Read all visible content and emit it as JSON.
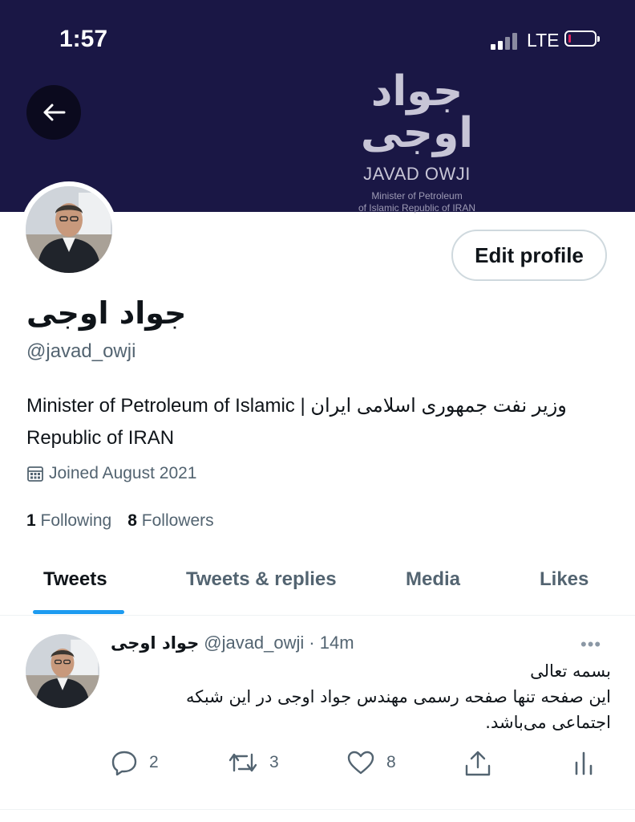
{
  "status_bar": {
    "time": "1:57",
    "network": "LTE"
  },
  "banner": {
    "logo_fa": "جواد اوجی",
    "logo_en": "JAVAD OWJI",
    "logo_sub1": "Minister of Petroleum",
    "logo_sub2": "of Islamic Republic of IRAN",
    "color": "#1a1745"
  },
  "profile": {
    "name": "جواد اوجی",
    "handle": "@javad_owji",
    "bio": "Minister of Petroleum of Islamic | وزیر نفت جمهوری اسلامی ایران Republic of IRAN",
    "joined": "Joined August 2021",
    "following_count": "1",
    "following_label": "Following",
    "followers_count": "8",
    "followers_label": "Followers",
    "edit_label": "Edit profile"
  },
  "tabs": [
    {
      "label": "Tweets",
      "active": true
    },
    {
      "label": "Tweets & replies",
      "active": false
    },
    {
      "label": "Media",
      "active": false
    },
    {
      "label": "Likes",
      "active": false
    }
  ],
  "tweet": {
    "name": "جواد اوجی",
    "handle": "@javad_owji",
    "time": "· 14m",
    "line1": "بسمه تعالی",
    "line2": "این صفحه تنها صفحه رسمی مهندس جواد اوجی در این شبکه اجتماعی می‌باشد.",
    "replies": "2",
    "retweets": "3",
    "likes": "8",
    "more": "•••"
  },
  "colors": {
    "accent": "#1d9bf0",
    "muted": "#536471",
    "text": "#0f1419"
  }
}
